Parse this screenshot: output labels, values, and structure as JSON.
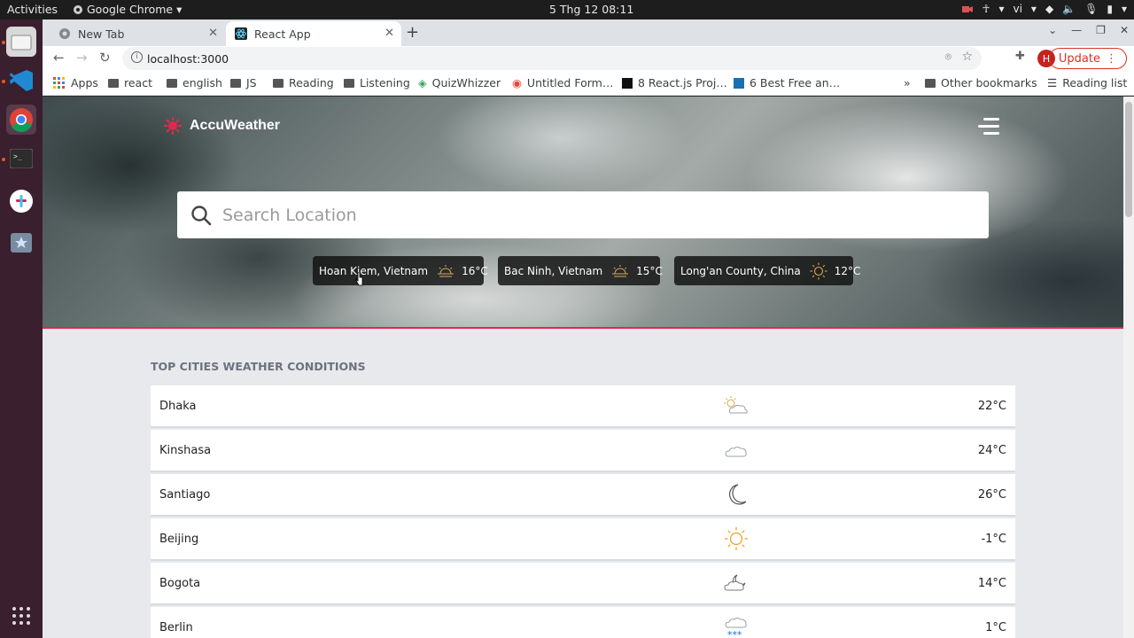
{
  "os": {
    "activities": "Activities",
    "app_name": "Google Chrome",
    "clock": "5 Thg 12  08:11",
    "lang": "vi"
  },
  "browser": {
    "tabs": [
      {
        "label": "New Tab"
      },
      {
        "label": "React App"
      }
    ],
    "url": "localhost:3000",
    "update_label": "Update",
    "profile_initial": "H",
    "bookmarks": [
      "Apps",
      "react",
      "english",
      "JS",
      "Reading",
      "Listening",
      "QuizWhizzer",
      "Untitled Form…",
      "8 React.js Proj…",
      "6 Best Free an…"
    ],
    "bookmarks_more": "»",
    "other_bookmarks": "Other bookmarks",
    "reading_list": "Reading list"
  },
  "page": {
    "brand": "AccuWeather",
    "search_placeholder": "Search Location",
    "recent_locations": [
      {
        "name": "Hoan Kiem, Vietnam",
        "temp": "16°C",
        "icon": "sunrise-icon"
      },
      {
        "name": "Bac Ninh, Vietnam",
        "temp": "15°C",
        "icon": "sunrise-icon"
      },
      {
        "name": "Long'an County, China",
        "temp": "12°C",
        "icon": "sun-icon"
      }
    ],
    "top_cities_title": "TOP CITIES WEATHER CONDITIONS",
    "cities": [
      {
        "name": "Dhaka",
        "temp": "22°C",
        "icon": "partly-sunny-icon"
      },
      {
        "name": "Kinshasa",
        "temp": "24°C",
        "icon": "cloud-icon"
      },
      {
        "name": "Santiago",
        "temp": "26°C",
        "icon": "moon-icon"
      },
      {
        "name": "Beijing",
        "temp": "-1°C",
        "icon": "sun-icon"
      },
      {
        "name": "Bogota",
        "temp": "14°C",
        "icon": "cloudy-night-icon"
      },
      {
        "name": "Berlin",
        "temp": "1°C",
        "icon": "snow-icon"
      }
    ]
  },
  "colors": {
    "accent": "#e2284f",
    "sun": "#f0a030"
  }
}
